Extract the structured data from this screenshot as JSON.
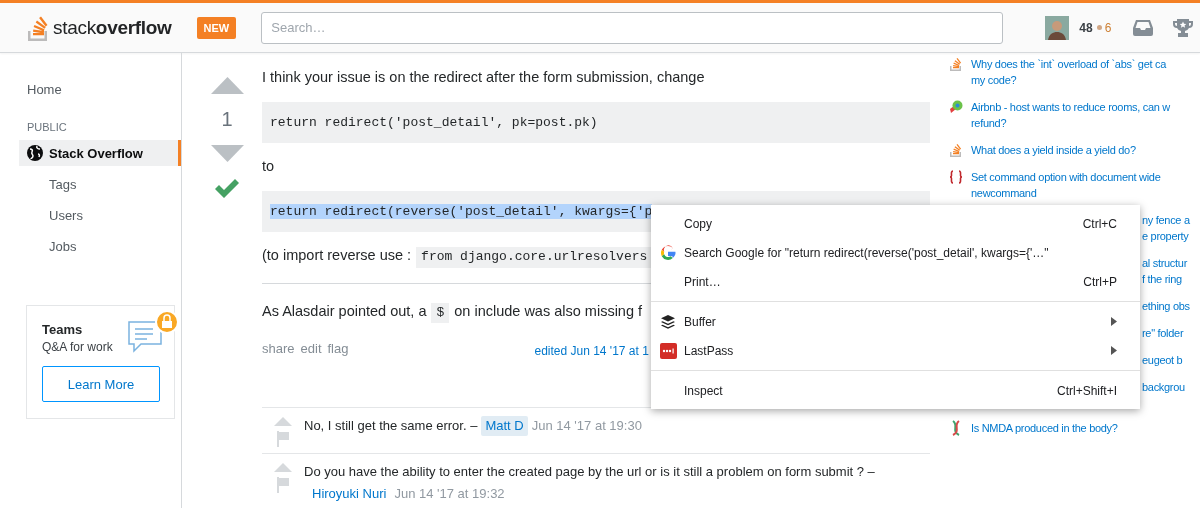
{
  "header": {
    "logo": "stack**overflow**",
    "badge": "NEW",
    "search": {
      "placeholder": "Search…"
    },
    "reputation": "48",
    "bronze": "6"
  },
  "nav": {
    "items": [
      {
        "label": "Home",
        "kind": "top",
        "selected": false
      },
      {
        "label": "PUBLIC",
        "kind": "heading"
      },
      {
        "label": "Stack Overflow",
        "kind": "site",
        "selected": true
      },
      {
        "label": "Tags",
        "kind": "sub",
        "selected": false
      },
      {
        "label": "Users",
        "kind": "sub",
        "selected": false
      },
      {
        "label": "Jobs",
        "kind": "sub",
        "selected": false
      }
    ],
    "teams": {
      "title": "Teams",
      "subtitle": "Q&A for work",
      "button": "Learn More"
    }
  },
  "answer": {
    "score": "1",
    "accepted": true,
    "blocks": [
      {
        "kind": "paragraph",
        "parts": [
          {
            "kind": "text",
            "text": "I think your issue is on the redirect after the form submission, change"
          }
        ]
      },
      {
        "kind": "code",
        "text": "return redirect('post_detail', pk=post.pk)",
        "selected": false
      },
      {
        "kind": "paragraph",
        "parts": [
          {
            "kind": "text",
            "text": "to"
          }
        ]
      },
      {
        "kind": "code",
        "text": "return redirect(reverse('post_detail', kwargs={'p",
        "selected": true
      },
      {
        "kind": "paragraph",
        "parts": [
          {
            "kind": "text",
            "text": "(to import reverse use :"
          },
          {
            "kind": "code",
            "text": "from django.core.urlresolvers"
          }
        ]
      },
      {
        "kind": "rule"
      },
      {
        "kind": "paragraph",
        "parts": [
          {
            "kind": "text",
            "text": "As Alasdair pointed out, a"
          },
          {
            "kind": "code",
            "text": "$"
          },
          {
            "kind": "text",
            "text": "on include was also missing f"
          }
        ]
      }
    ],
    "actions": [
      "share",
      "edit",
      "flag"
    ],
    "edited": "edited Jun 14 '17 at 1",
    "comments": [
      {
        "text": "No, I still get the same error. –",
        "user": "Matt D",
        "user_highlighted": true,
        "time": "Jun 14 '17 at 19:30"
      },
      {
        "text": "Do you have the ability to enter the created page by the url or is it still a problem on form submit ? –",
        "user": "Hiroyuki Nuri",
        "user_highlighted": false,
        "time": "Jun 14 '17 at 19:32"
      }
    ]
  },
  "hot_questions": [
    {
      "kind": "full",
      "lines": [
        "Why does the `int` overload of `abs` get ca",
        "my code?"
      ]
    },
    {
      "kind": "full",
      "lines": [
        "Airbnb - host wants to reduce rooms, can w",
        "refund?"
      ]
    },
    {
      "kind": "full",
      "lines": [
        "What does a yield inside a yield do?"
      ]
    },
    {
      "kind": "full",
      "lines": [
        "Set command option with document wide",
        "newcommand"
      ]
    },
    {
      "kind": "partial",
      "lines": [
        "ny fence a",
        "e property"
      ]
    },
    {
      "kind": "partial",
      "lines": [
        "al structur",
        "f the ring"
      ]
    },
    {
      "kind": "partial",
      "lines": [
        "ething obs"
      ]
    },
    {
      "kind": "partial",
      "lines": [
        "re\" folder"
      ]
    },
    {
      "kind": "partial",
      "lines": [
        "eugeot b"
      ]
    },
    {
      "kind": "partial",
      "lines": [
        "backgrou"
      ]
    },
    {
      "kind": "full",
      "lines": [
        "Is NMDA produced in the body?"
      ]
    }
  ],
  "context_menu": {
    "groups": [
      [
        {
          "label": "Copy",
          "shortcut": "Ctrl+C",
          "submenu": false
        },
        {
          "label": "Search Google for \"return redirect(reverse('post_detail', kwargs={'…\"",
          "submenu": false
        },
        {
          "label": "Print…",
          "shortcut": "Ctrl+P",
          "submenu": false
        }
      ],
      [
        {
          "label": "Buffer",
          "submenu": true
        },
        {
          "label": "LastPass",
          "submenu": true
        }
      ],
      [
        {
          "label": "Inspect",
          "shortcut": "Ctrl+Shift+I",
          "submenu": false
        }
      ]
    ]
  }
}
